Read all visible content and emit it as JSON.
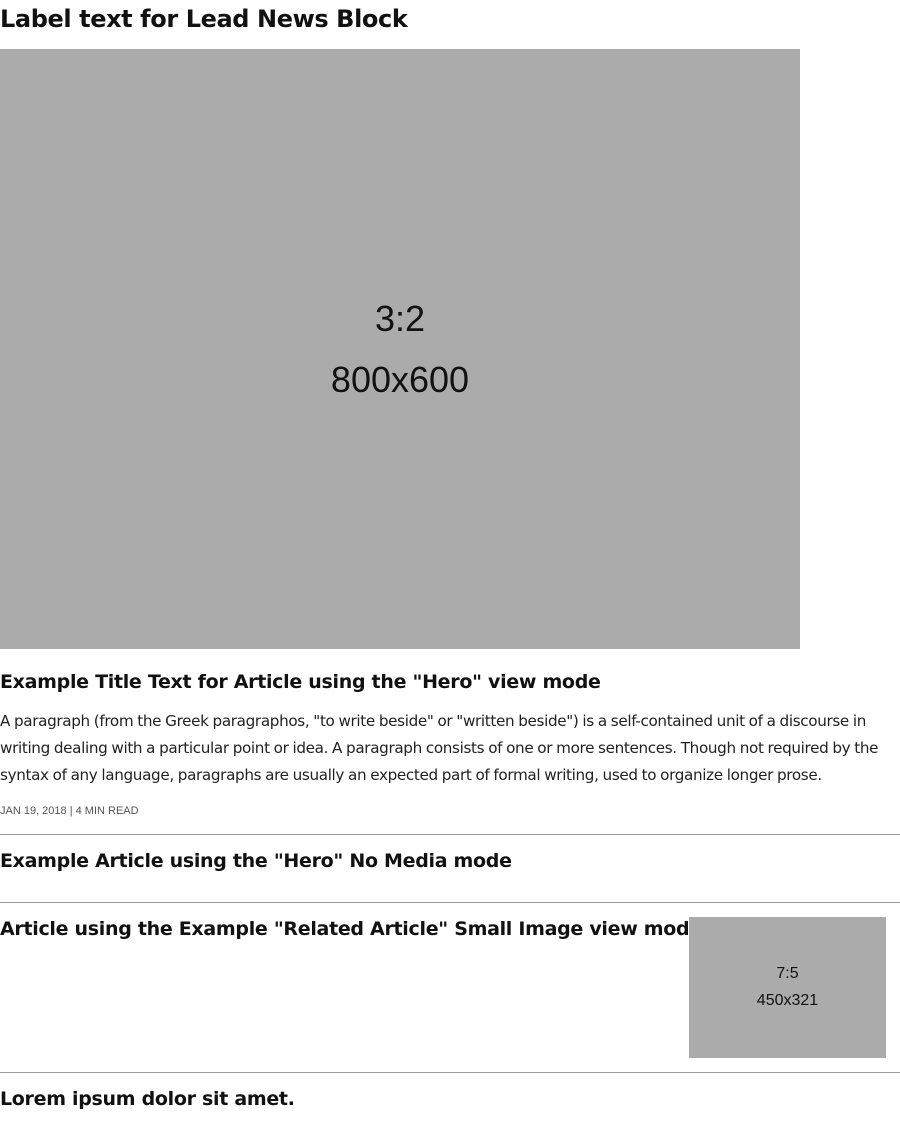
{
  "lead_block": {
    "label": "Label text for Lead News Block"
  },
  "hero": {
    "image": {
      "ratio": "3:2",
      "dimensions": "800x600"
    },
    "title": "Example Title Text for Article using the \"Hero\" view mode",
    "summary": "A paragraph (from the Greek paragraphos, \"to write beside\" or \"written beside\") is a self-contained unit of a discourse in writing dealing with a particular point or idea. A paragraph consists of one or more sentences. Though not required by the syntax of any language, paragraphs are usually an expected part of formal writing, used to organize longer prose.",
    "meta": "JAN 19, 2018 | 4 MIN READ"
  },
  "hero_no_media": {
    "title": "Example Article using the \"Hero\" No Media mode"
  },
  "related_small_image": {
    "title": "Article using the Example \"Related Article\" Small Image view mode.",
    "image": {
      "ratio": "7:5",
      "dimensions": "450x321"
    }
  },
  "lorem_article": {
    "title": "Lorem ipsum dolor sit amet."
  },
  "colors": {
    "placeholder_gray": "#ababab",
    "divider": "#9a9a9a",
    "text": "#111111"
  }
}
